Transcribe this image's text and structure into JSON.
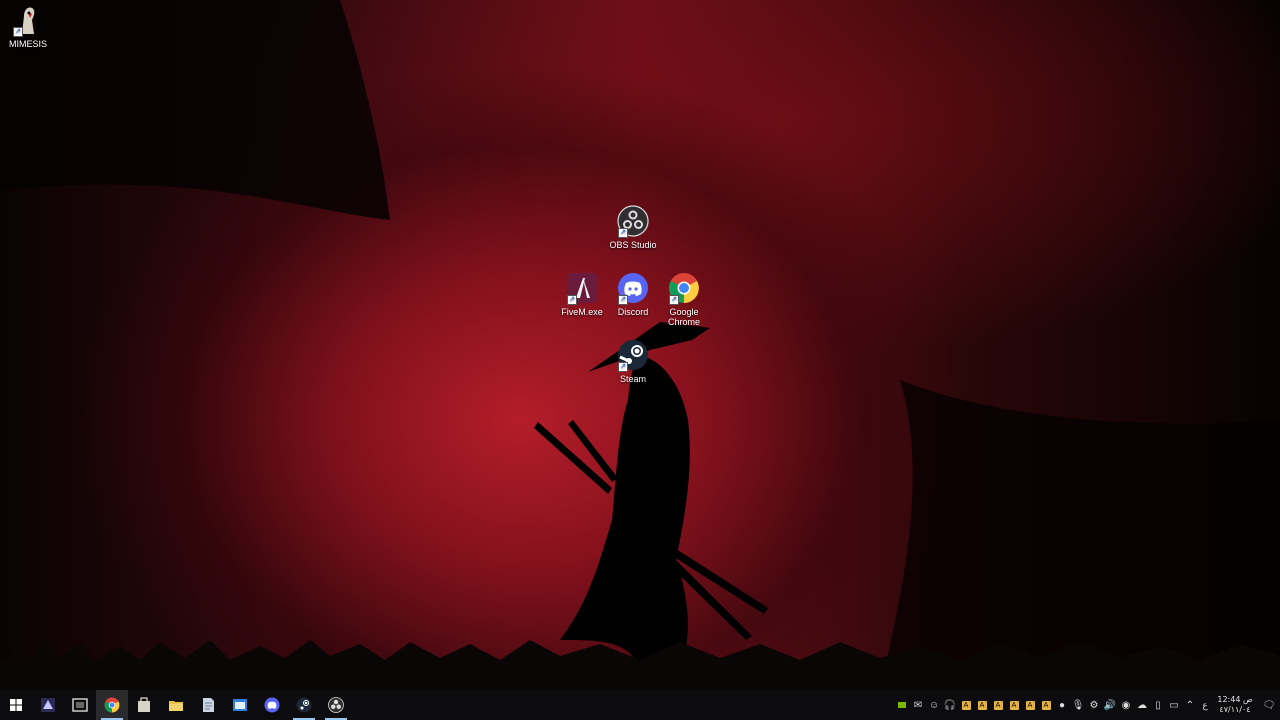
{
  "desktop": {
    "icons": [
      {
        "label": "MIMESIS",
        "icon": "mimesis-icon"
      },
      {
        "label": "OBS Studio",
        "icon": "obs-icon"
      },
      {
        "label": "FiveM.exe",
        "icon": "fivem-icon"
      },
      {
        "label": "Discord",
        "icon": "discord-icon"
      },
      {
        "label": "Google Chrome",
        "icon": "chrome-icon"
      },
      {
        "label": "Steam",
        "icon": "steam-icon"
      }
    ]
  },
  "taskbar": {
    "pinned": [
      {
        "icon": "start-icon"
      },
      {
        "icon": "unknown-app-icon"
      },
      {
        "icon": "screen-capture-icon"
      },
      {
        "icon": "chrome-icon",
        "active": true
      },
      {
        "icon": "store-icon"
      },
      {
        "icon": "file-explorer-icon"
      },
      {
        "icon": "document-icon"
      },
      {
        "icon": "window-app-icon"
      },
      {
        "icon": "discord-icon"
      },
      {
        "icon": "steam-icon"
      },
      {
        "icon": "obs-icon"
      }
    ],
    "tray": {
      "language": "ع",
      "time": "12:44 ص",
      "date": "٤٧/١١/٠٤"
    }
  },
  "colors": {
    "taskbar": "#0c0c0e",
    "wallpaper_red": "#b91e2a",
    "accent": "#9ac4f0"
  }
}
